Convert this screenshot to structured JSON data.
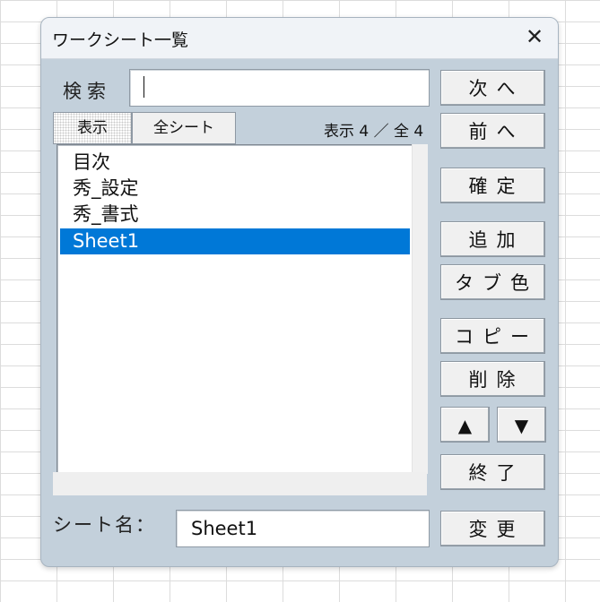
{
  "window": {
    "title": "ワークシート一覧",
    "close_glyph": "✕"
  },
  "search": {
    "label": "検索",
    "value": ""
  },
  "tabs": [
    {
      "label": "表示",
      "active": true
    },
    {
      "label": "全シート",
      "active": false
    }
  ],
  "count_text": "表示 4 ／ 全 4",
  "sheets": [
    {
      "name": "目次",
      "selected": false
    },
    {
      "name": "秀_設定",
      "selected": false
    },
    {
      "name": "秀_書式",
      "selected": false
    },
    {
      "name": "Sheet1",
      "selected": true
    }
  ],
  "buttons": {
    "next": "次へ",
    "prev": "前へ",
    "confirm": "確定",
    "add": "追加",
    "tab_color": "タブ色",
    "copy": "コピー",
    "delete": "削除",
    "move_up": "▲",
    "move_down": "▼",
    "exit": "終了",
    "rename": "変更"
  },
  "sheet_name": {
    "label": "シート名：",
    "value": "Sheet1"
  },
  "colors": {
    "dialog_bg": "#c3d0db",
    "selection": "#0078d7"
  }
}
